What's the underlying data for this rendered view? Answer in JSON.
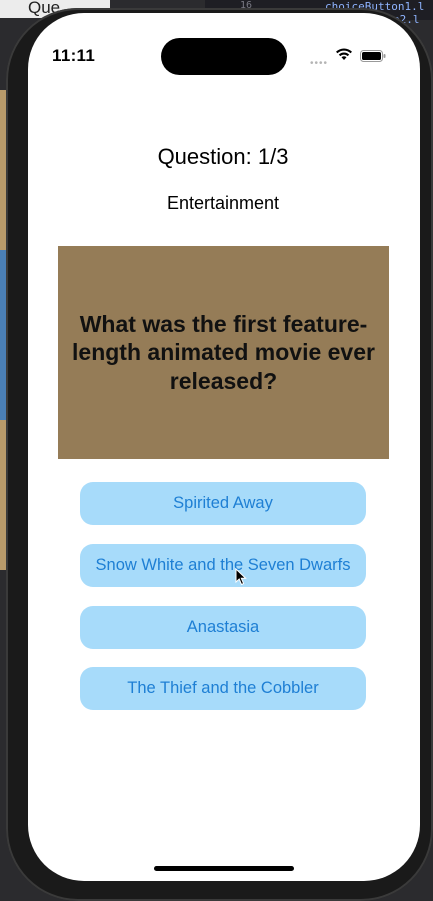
{
  "background": {
    "left_text": "Que",
    "line_number": "16",
    "code_line_1": "choiceButton1.l",
    "code_line_2": "e2.l"
  },
  "status_bar": {
    "time": "11:11",
    "signal_icon": "signal-dots-icon",
    "wifi_icon": "wifi-icon",
    "battery_icon": "battery-icon"
  },
  "quiz": {
    "counter": "Question: 1/3",
    "category": "Entertainment",
    "question": "What was the first feature-length animated movie ever released?",
    "question_bg": "#957c57",
    "choices": [
      {
        "label": "Spirited Away"
      },
      {
        "label": "Snow White and the Seven Dwarfs"
      },
      {
        "label": "Anastasia"
      },
      {
        "label": "The Thief and the Cobbler"
      }
    ],
    "choice_bg": "#a7dbfa",
    "choice_text_color": "#1e7fd4"
  }
}
